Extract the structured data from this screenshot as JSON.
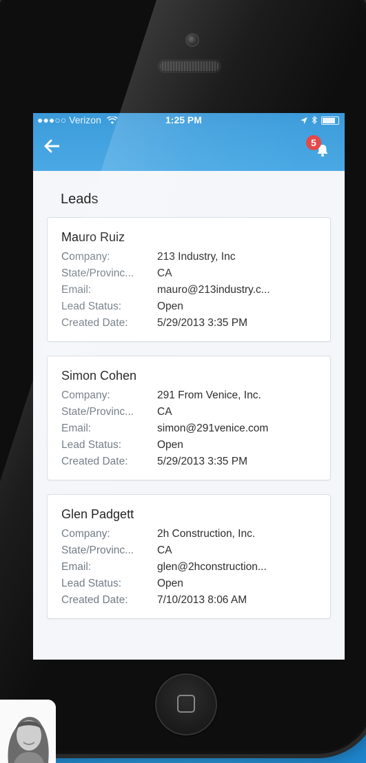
{
  "status_bar": {
    "carrier": "●●●○○ Verizon",
    "time": "1:25 PM"
  },
  "notifications": {
    "badge_count": "5"
  },
  "page": {
    "title": "Leads"
  },
  "leads": [
    {
      "name": "Mauro Ruiz",
      "fields": [
        {
          "label": "Company:",
          "value": "213 Industry, Inc"
        },
        {
          "label": "State/Provinc...",
          "value": "CA"
        },
        {
          "label": "Email:",
          "value": "mauro@213industry.c..."
        },
        {
          "label": "Lead Status:",
          "value": "Open"
        },
        {
          "label": "Created Date:",
          "value": "5/29/2013 3:35 PM"
        }
      ]
    },
    {
      "name": "Simon Cohen",
      "fields": [
        {
          "label": "Company:",
          "value": "291 From Venice, Inc."
        },
        {
          "label": "State/Provinc...",
          "value": "CA"
        },
        {
          "label": "Email:",
          "value": "simon@291venice.com"
        },
        {
          "label": "Lead Status:",
          "value": "Open"
        },
        {
          "label": "Created Date:",
          "value": "5/29/2013 3:35 PM"
        }
      ]
    },
    {
      "name": "Glen Padgett",
      "fields": [
        {
          "label": "Company:",
          "value": "2h Construction, Inc."
        },
        {
          "label": "State/Provinc...",
          "value": "CA"
        },
        {
          "label": "Email:",
          "value": "glen@2hconstruction..."
        },
        {
          "label": "Lead Status:",
          "value": "Open"
        },
        {
          "label": "Created Date:",
          "value": "7/10/2013 8:06 AM"
        }
      ]
    }
  ],
  "colors": {
    "header_blue": "#3f9fdd",
    "badge_red": "#e5494a",
    "background_blue": "#2f9fe0"
  },
  "icons": {
    "back": "back-arrow-icon",
    "notifications": "bell-icon",
    "wifi": "wifi-icon",
    "location": "location-arrow-icon",
    "bluetooth": "bluetooth-icon",
    "battery": "battery-icon"
  }
}
